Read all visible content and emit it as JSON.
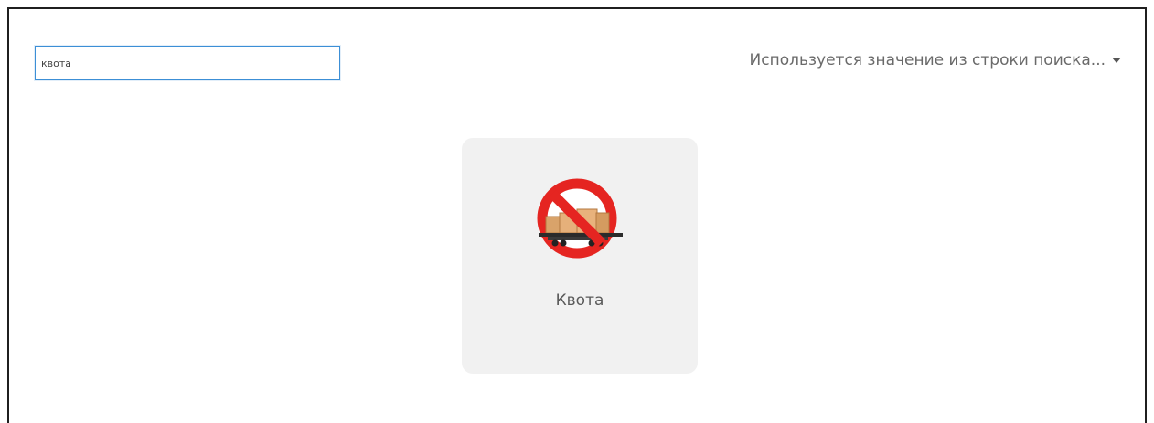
{
  "search": {
    "value": "квота",
    "placeholder": ""
  },
  "mode_select": {
    "label": "Используется значение из строки поиска..."
  },
  "results": [
    {
      "label": "Квота",
      "icon": "no-freight-wagon-icon"
    }
  ],
  "colors": {
    "accent_border": "#3c8fd6",
    "card_bg": "#f1f1f1",
    "prohibition_red": "#e52521"
  }
}
